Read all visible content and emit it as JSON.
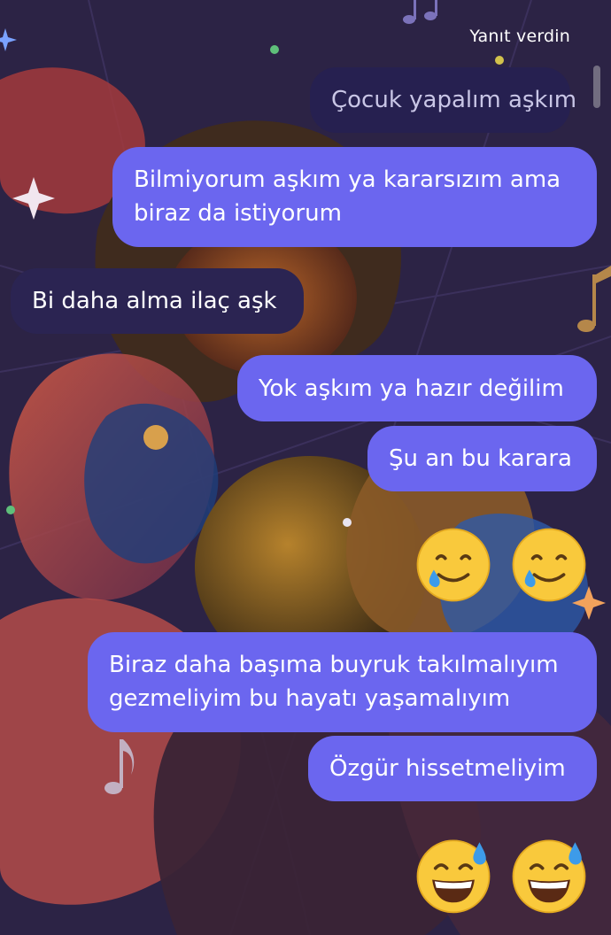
{
  "header": {
    "reply_note": "Yanıt verdin"
  },
  "messages": [
    {
      "type": "reply",
      "text": "Çocuk yapalım aşkım"
    },
    {
      "type": "sent",
      "lines": [
        "Bilmiyorum aşkım ya kararsızım ama",
        "biraz da istiyorum"
      ]
    },
    {
      "type": "received",
      "text": "Bi daha alma ilaç aşk"
    },
    {
      "type": "sent",
      "text": "Yok aşkım ya hazır değilim"
    },
    {
      "type": "sent",
      "text": "Şu an bu karara"
    },
    {
      "type": "emoji",
      "emoji": [
        "smiling-face-with-tear",
        "smiling-face-with-tear"
      ]
    },
    {
      "type": "sent",
      "lines": [
        "Biraz daha başıma buyruk takılmalıyım",
        "gezmeliyim bu hayatı yaşamalıyım"
      ]
    },
    {
      "type": "sent",
      "text": "Özgür hissetmeliyim"
    },
    {
      "type": "emoji",
      "emoji": [
        "grinning-face-with-sweat",
        "grinning-face-with-sweat"
      ]
    }
  ],
  "colors": {
    "sent_bubble": "#6b66ef",
    "received_bubble": "#2b2452",
    "reply_bubble": "#262050",
    "background": "#2c2345"
  }
}
